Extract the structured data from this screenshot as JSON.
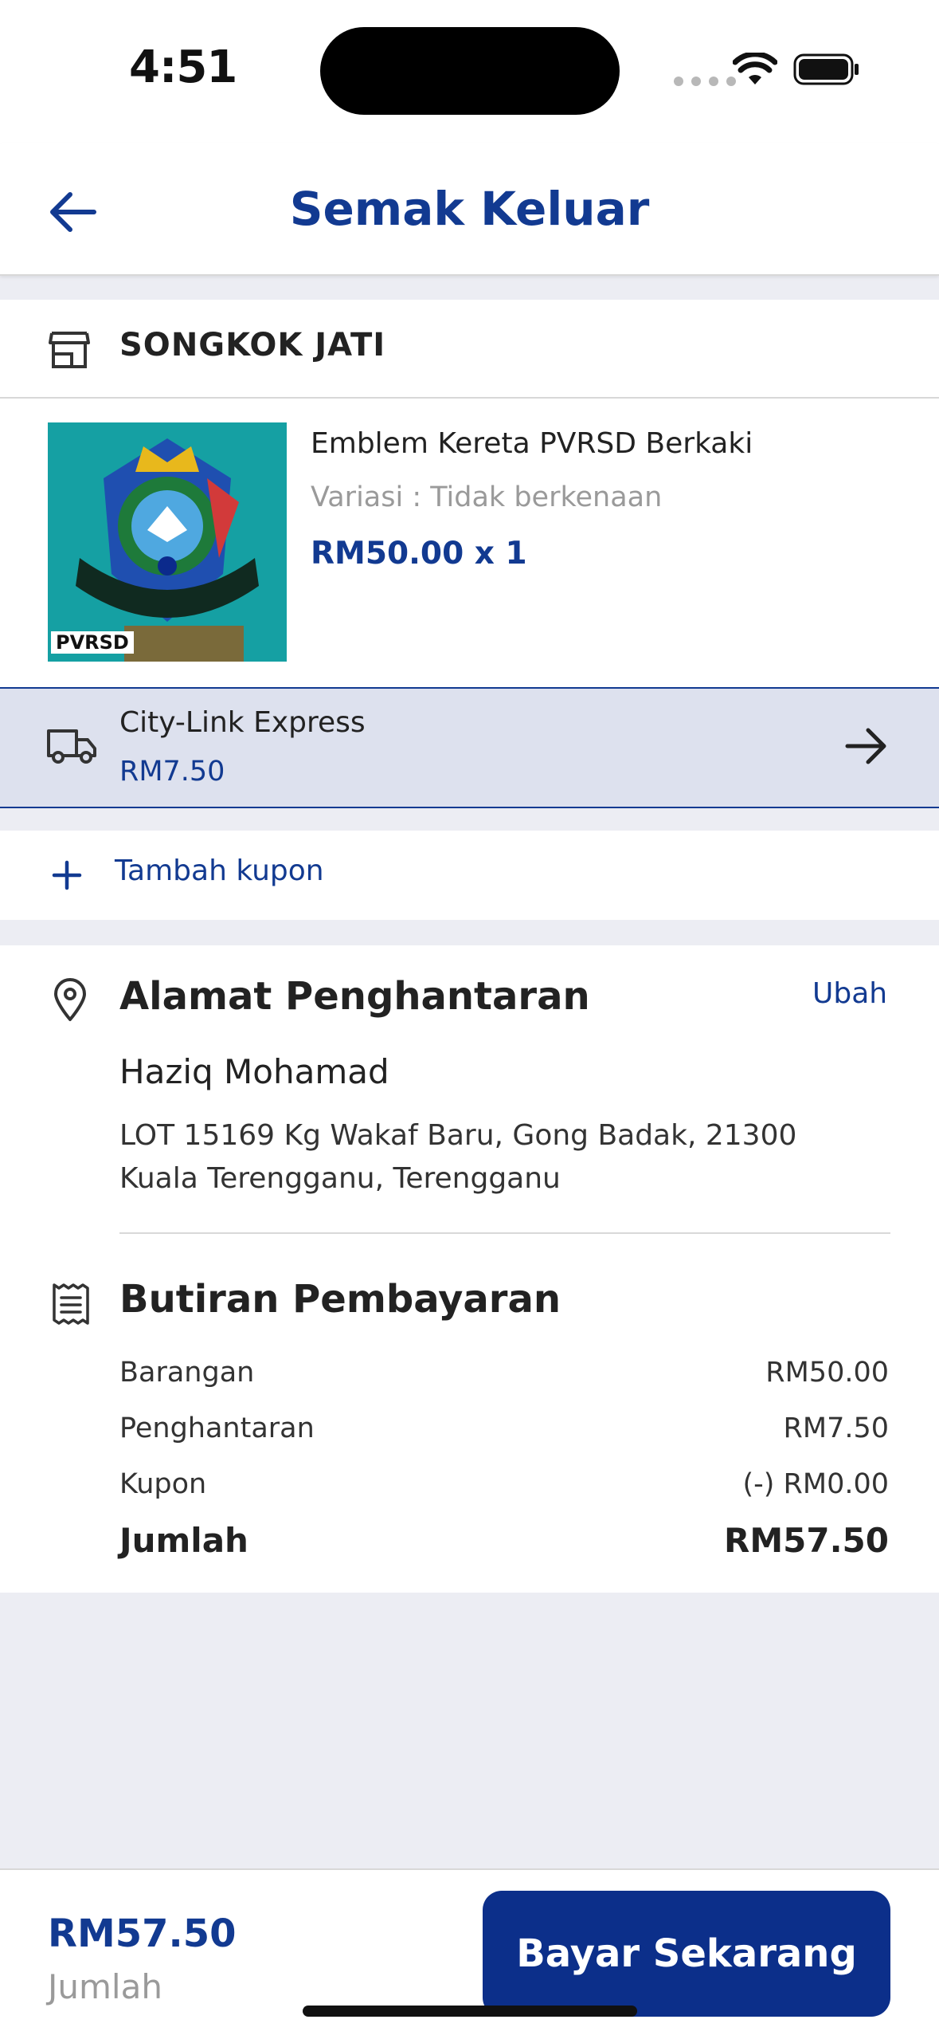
{
  "status_bar": {
    "time": "4:51"
  },
  "header": {
    "title": "Semak Keluar"
  },
  "shop": {
    "name": "SONGKOK JATI"
  },
  "product": {
    "image_label": "PVRSD",
    "title": "Emblem Kereta PVRSD Berkaki",
    "variant": "Variasi : Tidak berkenaan",
    "price": "RM50.00 x 1"
  },
  "shipping": {
    "courier": "City-Link Express",
    "price": "RM7.50"
  },
  "coupon": {
    "label": "Tambah kupon"
  },
  "address": {
    "heading": "Alamat Penghantaran",
    "edit_label": "Ubah",
    "name": "Haziq Mohamad",
    "line": "LOT 15169 Kg Wakaf Baru, Gong Badak, 21300 Kuala Terengganu, Terengganu"
  },
  "payment": {
    "heading": "Butiran Pembayaran",
    "rows": [
      {
        "label": "Barangan",
        "value": "RM50.00"
      },
      {
        "label": "Penghantaran",
        "value": "RM7.50"
      },
      {
        "label": "Kupon",
        "value": "(-) RM0.00"
      }
    ],
    "total": {
      "label": "Jumlah",
      "value": "RM57.50"
    }
  },
  "bottom": {
    "amount": "RM57.50",
    "amount_label": "Jumlah",
    "pay_button": "Bayar Sekarang"
  },
  "colors": {
    "primary": "#123a91",
    "button": "#0c2f8a",
    "shipping_bg": "#dde1ee",
    "page_bg": "#ecedf3"
  }
}
